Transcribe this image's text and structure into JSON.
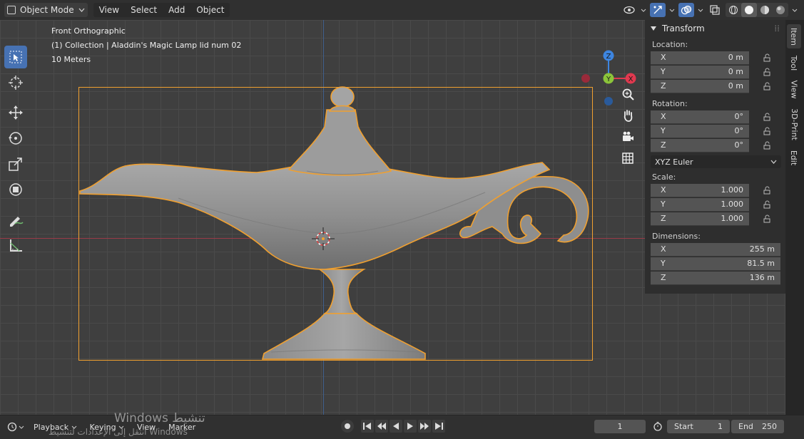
{
  "header": {
    "mode_label": "Object Mode",
    "menus": [
      "View",
      "Select",
      "Add",
      "Object"
    ]
  },
  "viewport": {
    "view_name": "Front Orthographic",
    "collection_line": "(1) Collection | Aladdin's Magic Lamp lid num 02",
    "scale_line": "10 Meters"
  },
  "gizmo": {
    "x": "X",
    "y": "Y",
    "z": "Z"
  },
  "npanel": {
    "section_title": "Transform",
    "location": {
      "label": "Location:",
      "x": "0 m",
      "y": "0 m",
      "z": "0 m"
    },
    "rotation": {
      "label": "Rotation:",
      "x": "0°",
      "y": "0°",
      "z": "0°",
      "mode": "XYZ Euler"
    },
    "scale": {
      "label": "Scale:",
      "x": "1.000",
      "y": "1.000",
      "z": "1.000"
    },
    "dimensions": {
      "label": "Dimensions:",
      "x": "255 m",
      "y": "81.5 m",
      "z": "136 m"
    },
    "axis_x": "X",
    "axis_y": "Y",
    "axis_z": "Z"
  },
  "tabs": [
    "Item",
    "Tool",
    "View",
    "3D-Print",
    "Edit"
  ],
  "timeline": {
    "menus": [
      "Playback",
      "Keying",
      "View",
      "Marker"
    ],
    "current_frame": "1",
    "start_label": "Start",
    "start_value": "1",
    "end_label": "End",
    "end_value": "250"
  },
  "watermark": {
    "line1": "Windows تنشيط",
    "line2": "انتقل إلى الإعدادات لتنشيط Windows"
  },
  "colors": {
    "accent": "#4772b3",
    "selection": "#f0a030",
    "axis_x": "#e0394f",
    "axis_y": "#8bc43a",
    "axis_z": "#3d85e0"
  }
}
